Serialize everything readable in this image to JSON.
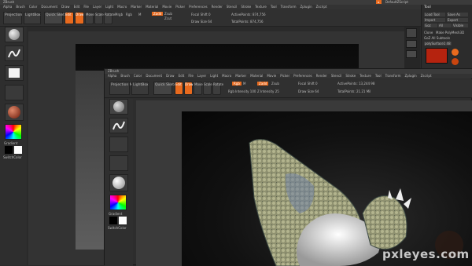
{
  "back_window": {
    "title": "ZBrush",
    "title_right": "DefaultZScript",
    "menu": [
      "Alpha",
      "Brush",
      "Color",
      "Document",
      "Draw",
      "Edit",
      "File",
      "Layer",
      "Light",
      "Macro",
      "Marker",
      "Material",
      "Movie",
      "Picker",
      "Preferences",
      "Render",
      "Stencil",
      "Stroke",
      "Texture",
      "Tool",
      "Transform",
      "Zplugin",
      "Zscript"
    ],
    "toolbar": {
      "projection_master": "Projection Master",
      "lightbox": "LightBox",
      "quick_sketch": "Quick Sketch",
      "edit": "Edit",
      "draw": "Draw",
      "move": "Move",
      "scale": "Scale",
      "rotate": "Rotate",
      "mrgb": "Mrgb",
      "rgb": "Rgb",
      "m": "M",
      "zadd": "Zadd",
      "zsub": "Zsub",
      "zcut": "Zcut",
      "focal_shift": "Focal Shift 0",
      "draw_size": "Draw Size 64",
      "active_points": "ActivePoints: 874,756",
      "total_points": "TotalPoints: 874,756"
    },
    "tray_swatches": [
      "Gradient",
      "SwitchColor"
    ]
  },
  "right_panel": {
    "title": "Tool",
    "buttons": [
      "Load Tool",
      "Save As",
      "Import",
      "Export",
      "Goz",
      "All",
      "Visible"
    ],
    "tool_name": "Clone",
    "tool_sub": "Make PolyMesh3D",
    "go_all": "GoZ All Subtools",
    "subtool_label": "polySurface1 48"
  },
  "front_window": {
    "title": "ZBrush",
    "menu": [
      "Alpha",
      "Brush",
      "Color",
      "Document",
      "Draw",
      "Edit",
      "File",
      "Layer",
      "Light",
      "Macro",
      "Marker",
      "Material",
      "Movie",
      "Picker",
      "Preferences",
      "Render",
      "Stencil",
      "Stroke",
      "Texture",
      "Tool",
      "Transform",
      "Zplugin",
      "Zscript"
    ],
    "toolbar": {
      "projection_master": "Projection Master",
      "lightbox": "LightBox",
      "quick_sketch": "Quick Sketch",
      "edit": "Edit",
      "draw": "Draw",
      "move": "Move",
      "scale": "Scale",
      "rotate": "Rotate",
      "rgb": "Rgb",
      "m": "M",
      "zadd": "Zadd",
      "zsub": "Zsub",
      "zcut": "Zcut",
      "focal_shift": "Focal Shift 0",
      "draw_size": "Draw Size 64",
      "rgb_intensity": "Rgb Intensity 100",
      "z_intensity": "Z Intensity 25",
      "active_points": "ActivePoints: 13,244 98",
      "total_points": "TotalPoints: 21.21 Mil"
    },
    "tray_swatches": [
      "Gradient",
      "SwitchColor"
    ]
  },
  "watermark": "pxleyes.com",
  "colors": {
    "accent": "#e86a1e",
    "panel": "#2d2d2d",
    "canvas_dark": "#0b0b0b",
    "sculpt_stone": "#9a9d7c",
    "sculpt_white": "#e8e8e8"
  }
}
